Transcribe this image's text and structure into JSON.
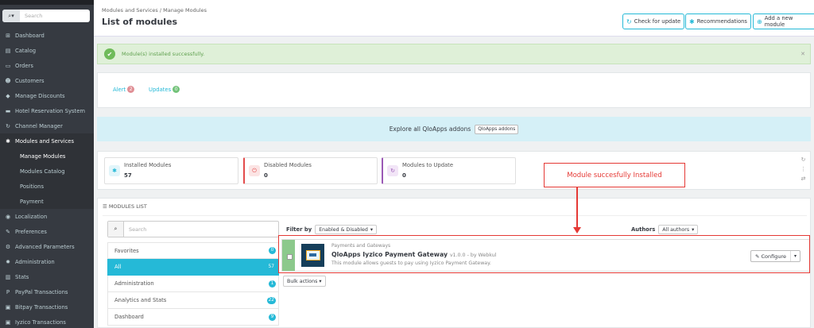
{
  "sidebar": {
    "search_placeholder": "Search",
    "search_icon_glyph": "⌕▾",
    "items": [
      {
        "label": "Dashboard",
        "icon": "⊞"
      },
      {
        "label": "Catalog",
        "icon": "▤"
      },
      {
        "label": "Orders",
        "icon": "▭"
      },
      {
        "label": "Customers",
        "icon": "☻"
      },
      {
        "label": "Manage Discounts",
        "icon": "◆"
      },
      {
        "label": "Hotel Reservation System",
        "icon": "▬"
      },
      {
        "label": "Channel Manager",
        "icon": "↻"
      },
      {
        "label": "Modules and Services",
        "icon": "✱"
      }
    ],
    "subitems": [
      "Manage Modules",
      "Modules Catalog",
      "Positions",
      "Payment"
    ],
    "items2": [
      {
        "label": "Localization",
        "icon": "◉"
      },
      {
        "label": "Preferences",
        "icon": "✎"
      },
      {
        "label": "Advanced Parameters",
        "icon": "⚙"
      },
      {
        "label": "Administration",
        "icon": "✹"
      },
      {
        "label": "Stats",
        "icon": "▥"
      },
      {
        "label": "PayPal Transactions",
        "icon": "P"
      },
      {
        "label": "Bitpay Transactions",
        "icon": "▣"
      },
      {
        "label": "Iyzico Transactions",
        "icon": "▣"
      }
    ]
  },
  "header": {
    "breadcrumb": "Modules and Services  /  Manage Modules",
    "title": "List of modules",
    "buttons": [
      {
        "label": "Check for update",
        "icon": "↻"
      },
      {
        "label": "Recommendations",
        "icon": "✱"
      },
      {
        "label": "Add a new module",
        "icon": "⊕"
      }
    ]
  },
  "alert": {
    "message": "Module(s) installed successfully.",
    "ok_glyph": "✔",
    "close_glyph": "✕"
  },
  "tabs": {
    "alert_label": "Alert",
    "alert_count": "2",
    "updates_label": "Updates",
    "updates_count": "0"
  },
  "addons": {
    "text": "Explore all QloApps addons",
    "button": "QloApps addons"
  },
  "kpis": [
    {
      "label": "Installed Modules",
      "value": "57",
      "icon": "✱",
      "color": "#25b9d7",
      "bg": "#e2f5fa"
    },
    {
      "label": "Disabled Modules",
      "value": "0",
      "icon": "⏻",
      "color": "#e34b4b",
      "bg": "#fbe4e4"
    },
    {
      "label": "Modules to Update",
      "value": "0",
      "icon": "↻",
      "color": "#9b59b6",
      "bg": "#f2e5f7"
    }
  ],
  "kpi_tools": [
    "↻",
    "⋮",
    "⇄"
  ],
  "modules_list": {
    "heading": "MODULES LIST",
    "heading_icon": "☰",
    "search_icon": "⌕",
    "search_placeholder": "Search",
    "categories": [
      {
        "label": "Favorites",
        "count": "0"
      },
      {
        "label": "All",
        "count": "57"
      },
      {
        "label": "Administration",
        "count": "1"
      },
      {
        "label": "Analytics and Stats",
        "count": "22"
      },
      {
        "label": "Dashboard",
        "count": "9"
      }
    ],
    "filter_label": "Filter by",
    "filter_value": "Enabled & Disabled",
    "authors_label": "Authors",
    "authors_value": "All authors",
    "caret": "▾",
    "module": {
      "category": "Payments and Gateways",
      "name": "QloApps Iyzico Payment Gateway",
      "version": "v1.0.0 - by Webkul",
      "description": "This module allows guests to pay using Iyzico Payment Gateway.",
      "configure_label": "Configure",
      "configure_icon": "✎"
    },
    "bulk_label": "Bulk actions"
  },
  "annotation": {
    "text": "Module succesfully Installed"
  }
}
